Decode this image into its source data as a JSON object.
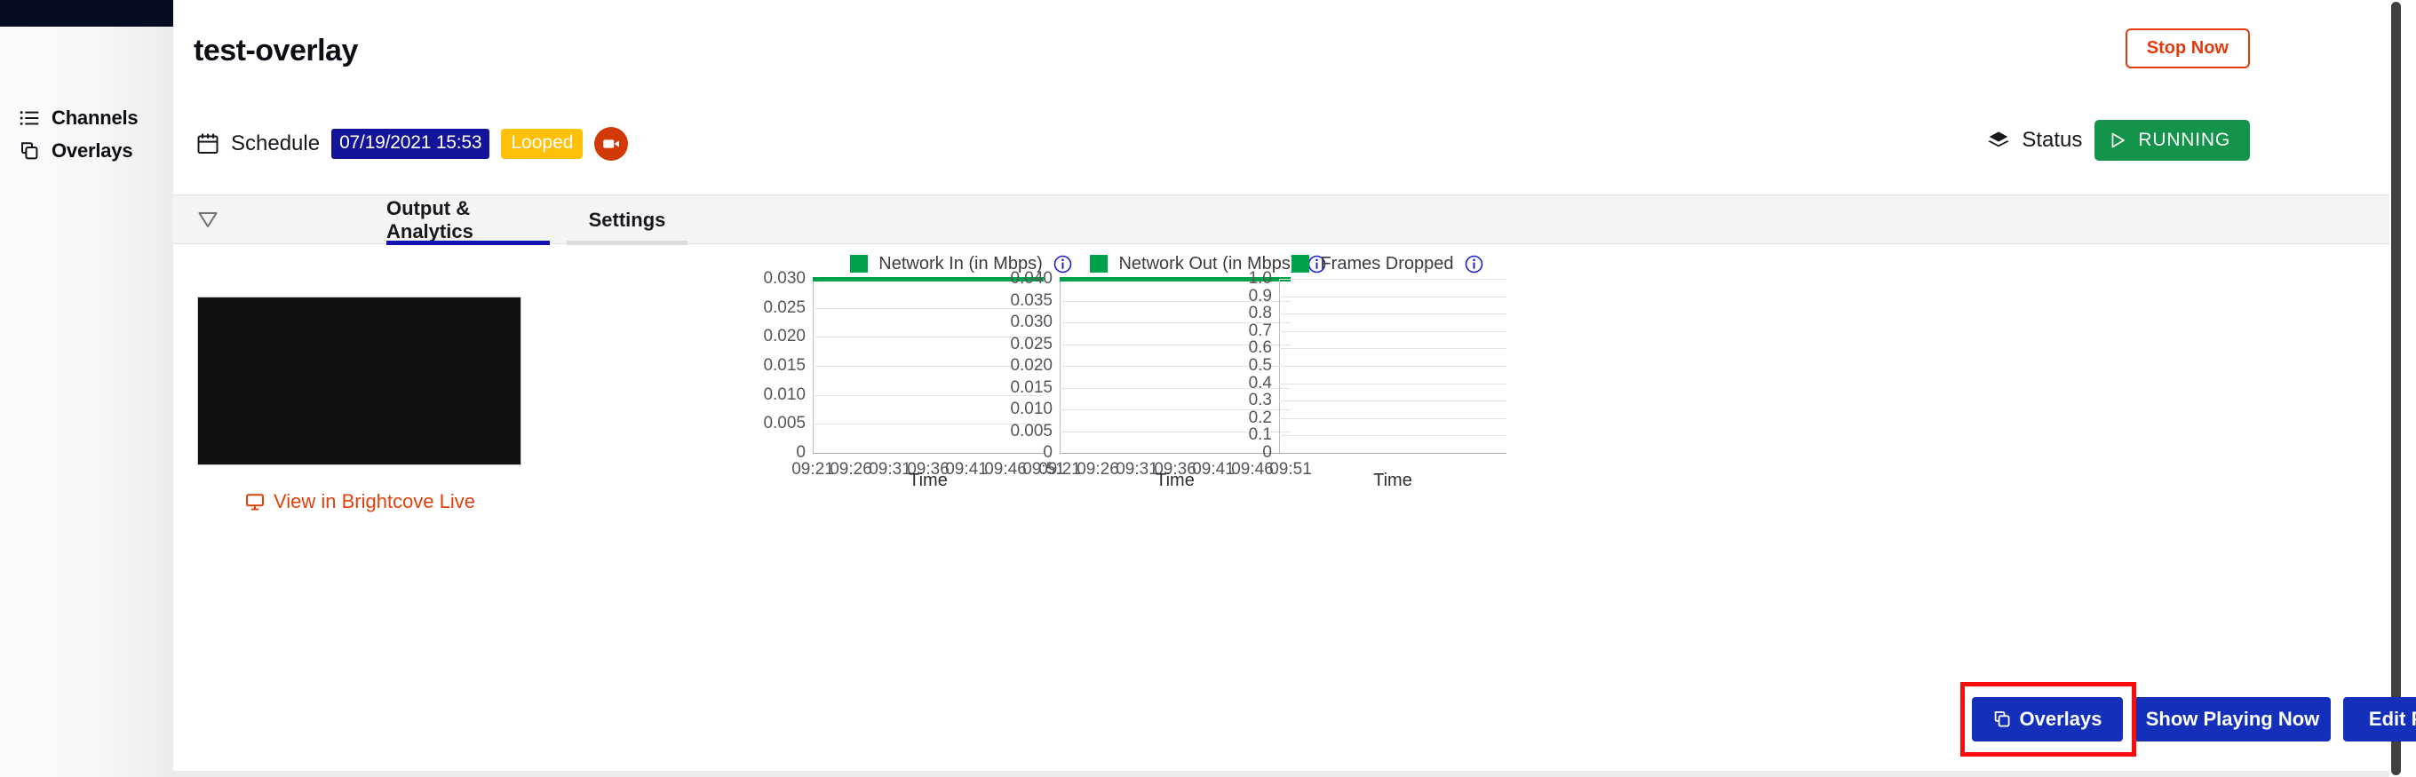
{
  "sidebar": {
    "items": [
      {
        "label": "Channels",
        "icon": "list-icon"
      },
      {
        "label": "Overlays",
        "icon": "copy-icon"
      }
    ]
  },
  "header": {
    "title": "test-overlay",
    "stop_button": "Stop Now",
    "schedule_label": "Schedule",
    "schedule_icon": "calendar-icon",
    "schedule_date": "07/19/2021 15:53",
    "loop_badge": "Looped",
    "camera_icon": "video-camera-icon",
    "status_label": "Status",
    "status_icon": "layers-icon",
    "status_value": "RUNNING",
    "status_play_icon": "play-icon"
  },
  "tabs": {
    "toggle_icon": "triangle-down-icon",
    "items": [
      {
        "label": "Output & Analytics",
        "active": true
      },
      {
        "label": "Settings",
        "active": false
      }
    ]
  },
  "preview": {
    "link_label": "View in Brightcove Live",
    "link_icon": "monitor-icon"
  },
  "actions": {
    "overlays": "Overlays",
    "overlays_icon": "copy-icon",
    "show_playing_now": "Show Playing Now",
    "edit_program": "Edit Program"
  },
  "colors": {
    "accent_blue": "#1430ba",
    "brand_orange": "#e0410d",
    "status_green": "#14934a",
    "badge_navy": "#14149b",
    "badge_amber": "#ffc107",
    "chart_green": "#00a14b",
    "highlight_red": "#fb0d0d",
    "navbar_dark": "#060d23"
  },
  "chart_data": [
    {
      "type": "line",
      "title": "Network In (in Mbps)",
      "info_icon": "info-icon",
      "xlabel": "Time",
      "ylabel": "",
      "categories": [
        "09:21",
        "09:26",
        "09:31",
        "09:36",
        "09:41",
        "09:46",
        "09:51"
      ],
      "values": [
        0.03,
        0.03,
        0.03,
        0.03,
        0.03,
        0.03,
        0.03
      ],
      "yticks": [
        "0.030",
        "0.025",
        "0.020",
        "0.015",
        "0.010",
        "0.005",
        "0"
      ],
      "ylim": [
        0,
        0.03
      ],
      "grid": true,
      "legend": "top-center",
      "series_color": "#00a14b"
    },
    {
      "type": "line",
      "title": "Network Out (in Mbps)",
      "info_icon": "info-icon",
      "xlabel": "Time",
      "ylabel": "",
      "categories": [
        "09:21",
        "09:26",
        "09:31",
        "09:36",
        "09:41",
        "09:46",
        "09:51"
      ],
      "values": [
        0.04,
        0.04,
        0.04,
        0.04,
        0.04,
        0.04,
        0.04
      ],
      "yticks": [
        "0.040",
        "0.035",
        "0.030",
        "0.025",
        "0.020",
        "0.015",
        "0.010",
        "0.005",
        "0"
      ],
      "ylim": [
        0,
        0.04
      ],
      "grid": true,
      "legend": "top-center",
      "series_color": "#00a14b"
    },
    {
      "type": "line",
      "title": "Frames Dropped",
      "info_icon": "info-icon",
      "xlabel": "Time",
      "ylabel": "",
      "categories": [],
      "values": [],
      "yticks": [
        "1.0",
        "0.9",
        "0.8",
        "0.7",
        "0.6",
        "0.5",
        "0.4",
        "0.3",
        "0.2",
        "0.1",
        "0"
      ],
      "ylim": [
        0,
        1.0
      ],
      "grid": true,
      "legend": "top-center",
      "series_color": "#00a14b"
    }
  ]
}
